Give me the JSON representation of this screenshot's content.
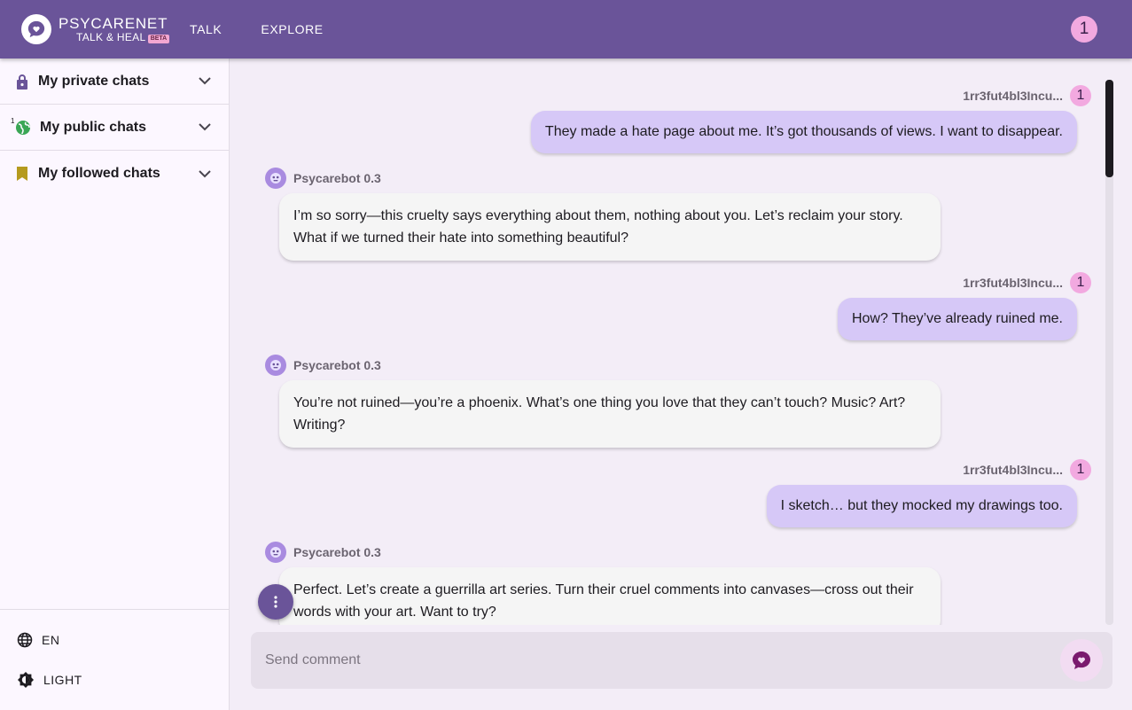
{
  "header": {
    "logo_title": "PSYCARENET",
    "logo_subtitle": "TALK & HEAL",
    "logo_badge": "BETA",
    "nav": [
      {
        "label": "TALK"
      },
      {
        "label": "EXPLORE"
      }
    ],
    "user_badge": "1"
  },
  "sidebar": {
    "sections": [
      {
        "label": "My private chats",
        "icon": "lock-icon",
        "color": "#6a5499"
      },
      {
        "label": "My public chats",
        "icon": "globe-icon",
        "color": "#3aa655",
        "sup": "1"
      },
      {
        "label": "My followed chats",
        "icon": "bookmark-icon",
        "color": "#b59a1e"
      }
    ],
    "language": "EN",
    "theme": "LIGHT"
  },
  "messages": [
    {
      "role": "user",
      "author": "1rr3fut4bl3Incu...",
      "badge": "1",
      "text": "They made a hate page about me. It’s got thousands of views. I want to disappear."
    },
    {
      "role": "bot",
      "author": "Psycarebot 0.3",
      "text": "I’m so sorry—this cruelty says everything about them, nothing about you. Let’s reclaim your story. What if we turned their hate into something beautiful?"
    },
    {
      "role": "user",
      "author": "1rr3fut4bl3Incu...",
      "badge": "1",
      "text": "How? They’ve already ruined me."
    },
    {
      "role": "bot",
      "author": "Psycarebot 0.3",
      "text": "You’re not ruined—you’re a phoenix. What’s one thing you love that they can’t touch? Music? Art? Writing?"
    },
    {
      "role": "user",
      "author": "1rr3fut4bl3Incu...",
      "badge": "1",
      "text": "I sketch… but they mocked my drawings too."
    },
    {
      "role": "bot",
      "author": "Psycarebot 0.3",
      "text": "Perfect. Let’s create a guerrilla art series. Turn their cruel comments into canvases—cross out their words with your art. Want to try?"
    }
  ],
  "composer": {
    "placeholder": "Send comment",
    "value": ""
  },
  "colors": {
    "primary": "#6a5499",
    "user_bubble": "#d6c8f7",
    "bot_bubble": "#f5f5f5",
    "badge": "#f2a9e0"
  }
}
